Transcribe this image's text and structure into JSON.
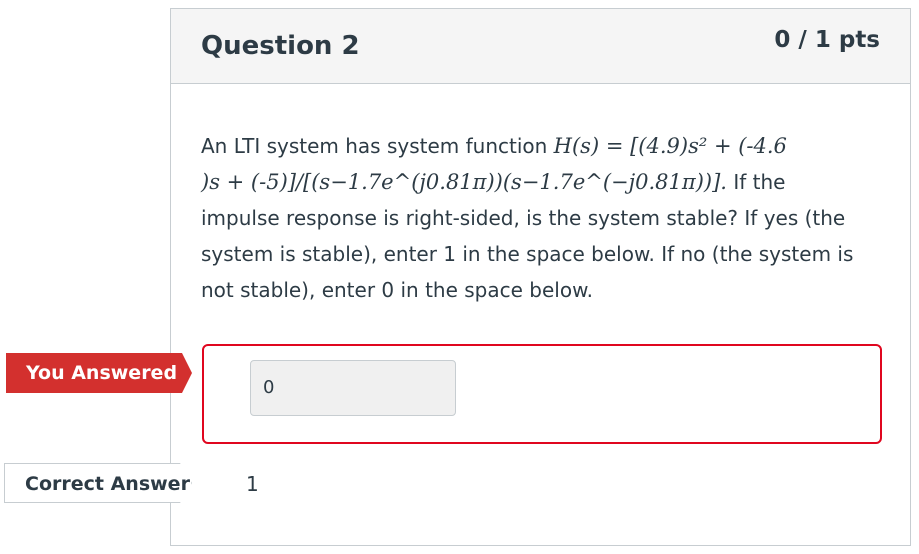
{
  "question": {
    "title": "Question 2",
    "points": "0 / 1 pts",
    "text_intro": "An LTI system has system function",
    "formula_line1": "H(s) = [(4.9)s² + (-4.6",
    "formula_line2": ")s + (-5)]/[(s−1.7e^(j0.81π))(s−1.7e^(−j0.81π))].",
    "text_rest_1": " If the",
    "text_rest_2": "impulse response is right-sided, is the system stable?  If yes (the",
    "text_rest_3": "system is stable), enter 1 in the space below.  If no (the system is",
    "text_rest_4": "not stable), enter 0 in the space below."
  },
  "answers": {
    "you_answered_label": "You Answered",
    "you_answered_value": "0",
    "correct_label": "Correct Answer",
    "correct_value": "1"
  },
  "colors": {
    "wrong": "#d3302e",
    "wrong_border": "#e0061f",
    "text": "#2d3b45"
  }
}
